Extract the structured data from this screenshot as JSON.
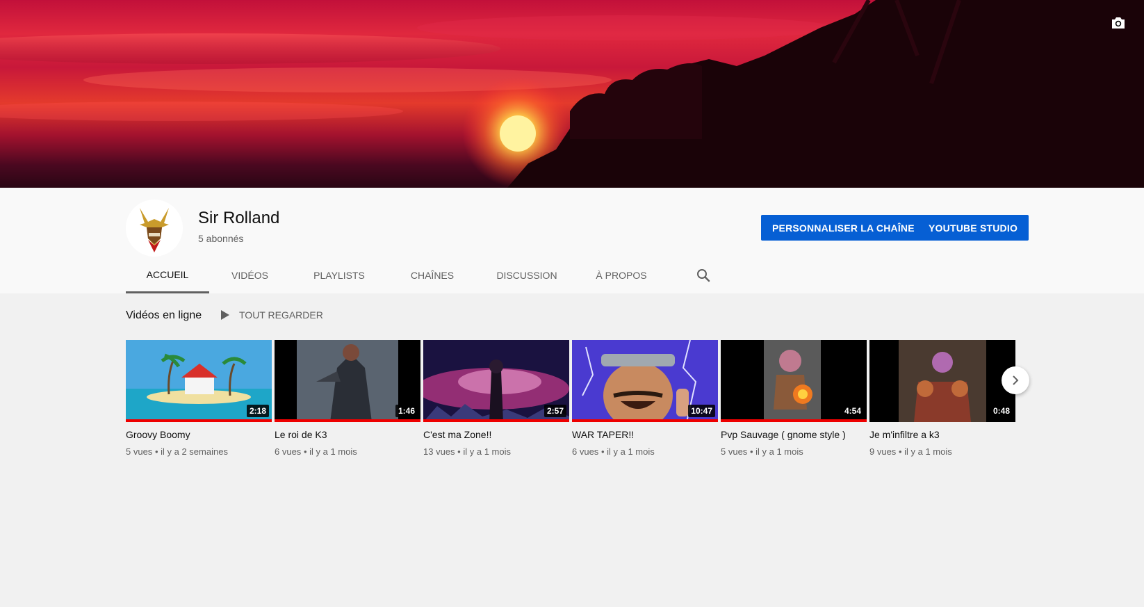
{
  "channel": {
    "name": "Sir Rolland",
    "subscribers": "5 abonnés"
  },
  "buttons": {
    "customize": "PERSONNALISER LA CHAÎNE",
    "studio": "YOUTUBE STUDIO"
  },
  "tabs": [
    {
      "label": "ACCUEIL",
      "active": true
    },
    {
      "label": "VIDÉOS"
    },
    {
      "label": "PLAYLISTS"
    },
    {
      "label": "CHAÎNES"
    },
    {
      "label": "DISCUSSION"
    },
    {
      "label": "À PROPOS"
    }
  ],
  "shelf": {
    "title": "Vidéos en ligne",
    "play_all": "TOUT REGARDER"
  },
  "videos": [
    {
      "title": "Groovy Boomy",
      "views": "5 vues",
      "age": "il y a 2 semaines",
      "duration": "2:18"
    },
    {
      "title": "Le roi de K3",
      "views": "6 vues",
      "age": "il y a 1 mois",
      "duration": "1:46"
    },
    {
      "title": "C'est ma Zone!!",
      "views": "13 vues",
      "age": "il y a 1 mois",
      "duration": "2:57"
    },
    {
      "title": "WAR TAPER!!",
      "views": "6 vues",
      "age": "il y a 1 mois",
      "duration": "10:47"
    },
    {
      "title": "Pvp Sauvage ( gnome style )",
      "views": "5 vues",
      "age": "il y a 1 mois",
      "duration": "4:54"
    },
    {
      "title": "Je m'infiltre a k3",
      "views": "9 vues",
      "age": "il y a 1 mois",
      "duration": "0:48"
    }
  ],
  "meta_separator": "•",
  "colors": {
    "brand_blue": "#065fd4",
    "progress_red": "#ee0000"
  },
  "icons": {
    "camera": "camera-icon",
    "search": "search-icon",
    "next": "chevron-right-icon",
    "play": "play-icon"
  }
}
